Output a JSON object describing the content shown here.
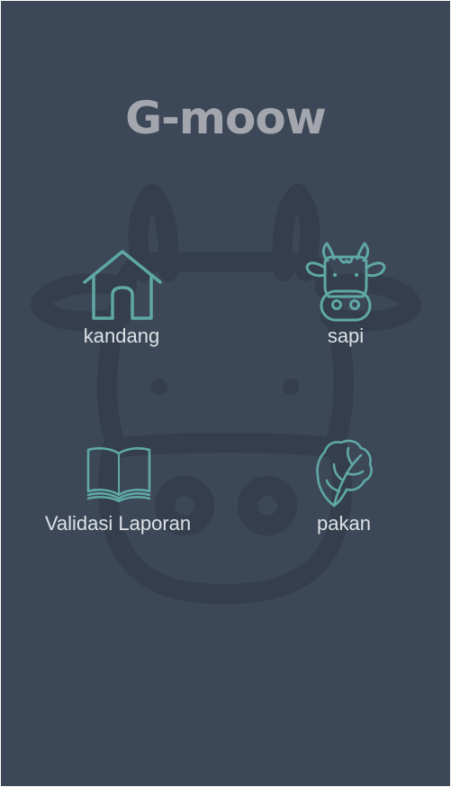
{
  "app": {
    "title": "G-moow"
  },
  "menu": {
    "items": [
      {
        "id": "kandang",
        "label": "kandang",
        "icon": "house-icon"
      },
      {
        "id": "sapi",
        "label": "sapi",
        "icon": "cow-head-icon"
      },
      {
        "id": "validasi",
        "label": "Validasi Laporan",
        "icon": "open-book-icon"
      },
      {
        "id": "pakan",
        "label": "pakan",
        "icon": "lettuce-icon"
      }
    ]
  },
  "colors": {
    "background": "#3c4757",
    "title": "#a3a6ad",
    "icon_accent": "#5fa8a6",
    "label": "#dde1e6",
    "watermark": "#343e4c"
  }
}
